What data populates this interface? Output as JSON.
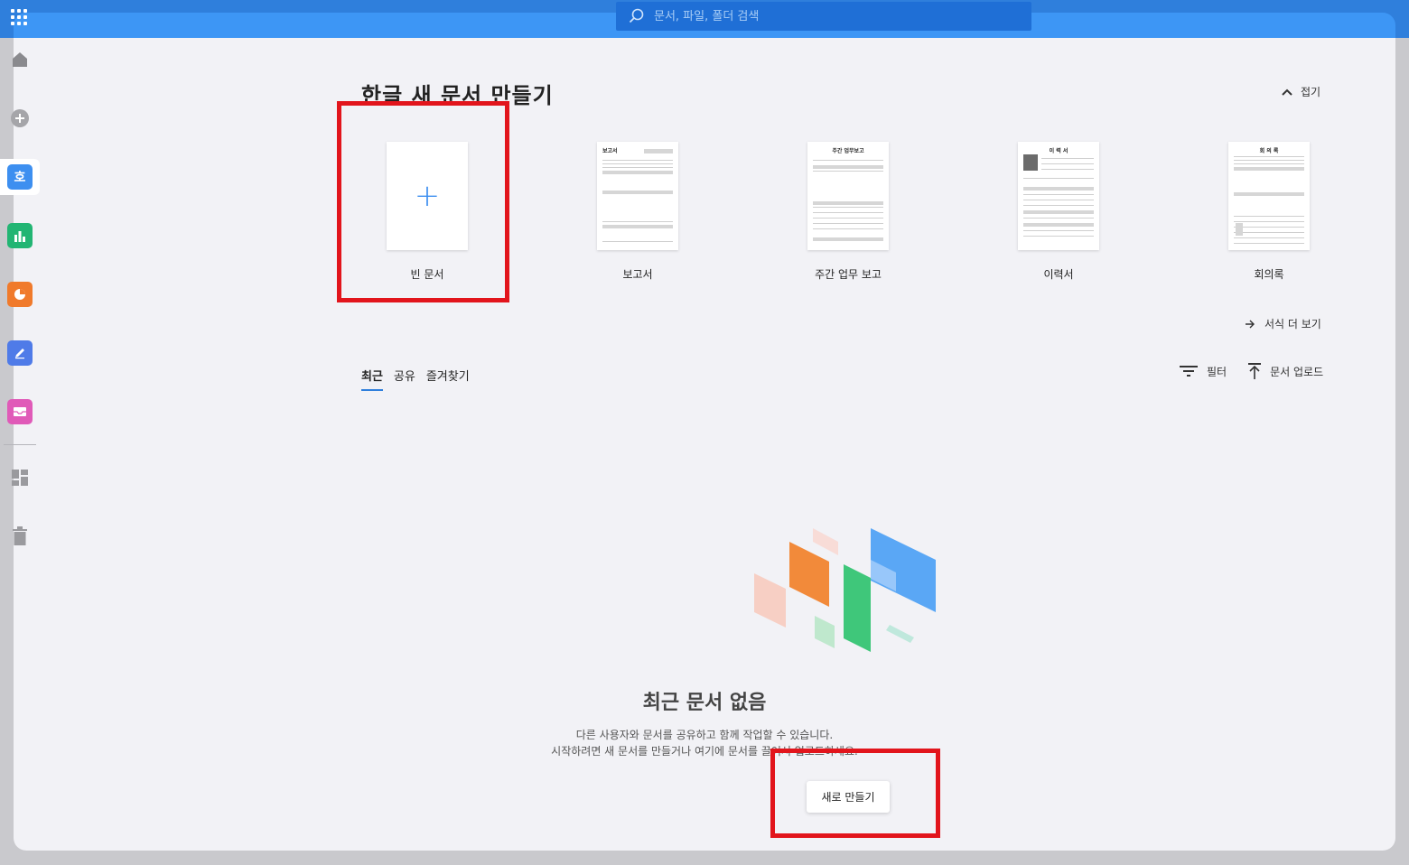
{
  "search": {
    "placeholder": "문서, 파일, 폴더 검색"
  },
  "rail": {
    "items": [
      {
        "name": "home-icon"
      },
      {
        "name": "add-icon"
      },
      {
        "name": "hangul-app",
        "glyph": "호",
        "color": "#3d8ff0"
      },
      {
        "name": "hancell-app",
        "color": "#22b573"
      },
      {
        "name": "hanshow-app",
        "color": "#f07a2b"
      },
      {
        "name": "note-app",
        "color": "#4f7be8"
      },
      {
        "name": "mail-app",
        "color": "#e05ab8"
      },
      {
        "name": "dashboard-icon"
      },
      {
        "name": "trash-icon"
      }
    ]
  },
  "main": {
    "title": "한글 새 문서 만들기",
    "collapse_label": "접기",
    "templates": [
      {
        "label": "빈 문서"
      },
      {
        "label": "보고서",
        "thumb_title": "보고서"
      },
      {
        "label": "주간 업무 보고",
        "thumb_title": "주간 업무보고"
      },
      {
        "label": "이력서",
        "thumb_title": "이 력 서"
      },
      {
        "label": "회의록",
        "thumb_title": "회 의 록"
      }
    ],
    "more_templates_label": "서식 더 보기",
    "tabs": [
      {
        "label": "최근",
        "active": true
      },
      {
        "label": "공유"
      },
      {
        "label": "즐겨찾기"
      }
    ],
    "filter_label": "필터",
    "upload_label": "문서 업로드",
    "empty": {
      "title": "최근 문서 없음",
      "line1": "다른 사용자와 문서를 공유하고 함께 작업할 수 있습니다.",
      "line2": "시작하려면 새 문서를 만들거나 여기에 문서를 끌어서 업로드하세요.",
      "button": "새로 만들기"
    }
  },
  "colors": {
    "accent": "#2f7fdc",
    "highlight": "#e2151c"
  }
}
